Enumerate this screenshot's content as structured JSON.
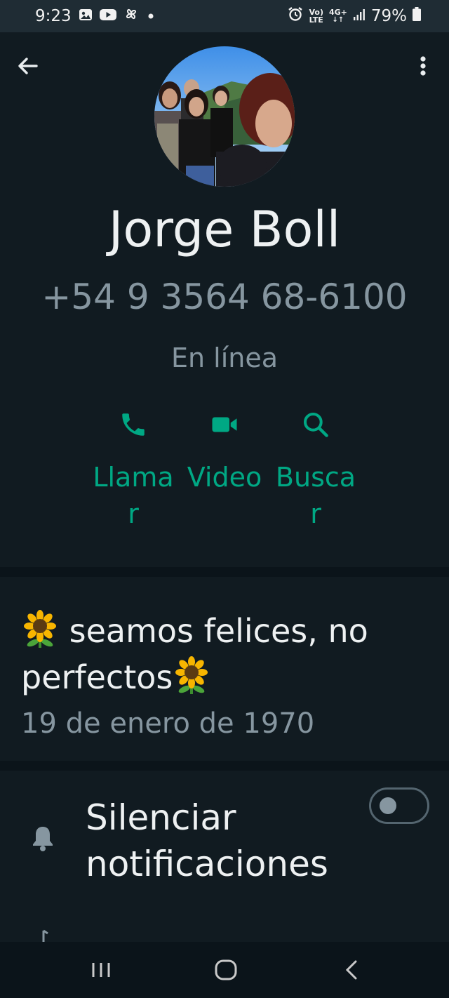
{
  "status_bar": {
    "time": "9:23",
    "left_icons": [
      "gallery-icon",
      "youtube-icon",
      "pinwheel-icon",
      "dot-icon"
    ],
    "net_top": "Vo)",
    "net_bottom": "LTE",
    "net_type": "4G+",
    "battery": "79%"
  },
  "header": {
    "back_icon": "arrow-left-icon",
    "menu_icon": "more-vert-icon"
  },
  "contact": {
    "name": "Jorge Boll",
    "phone": "+54 9 3564 68-6100",
    "presence": "En línea"
  },
  "actions": [
    {
      "label": "Llamar",
      "icon": "phone-icon"
    },
    {
      "label": "Video",
      "icon": "videocam-icon"
    },
    {
      "label": "Buscar",
      "icon": "search-icon"
    }
  ],
  "about": {
    "text": "seamos felices, no perfectos",
    "date": "19 de enero de 1970",
    "emoji": "sunflower-icon"
  },
  "settings": {
    "mute_label": "Silenciar notificaciones",
    "mute_enabled": false
  },
  "colors": {
    "background": "#111b21",
    "accent": "#00a884",
    "secondary_text": "#8696a0",
    "band": "#0b141a"
  }
}
